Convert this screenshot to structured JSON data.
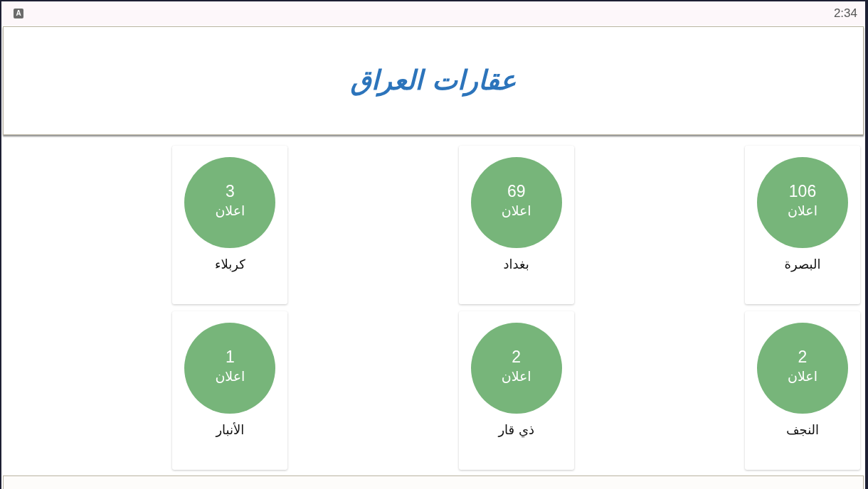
{
  "status_bar": {
    "notification_icon": "A",
    "time": "2:34"
  },
  "header": {
    "title": "عقارات العراق"
  },
  "cities": [
    {
      "name": "البصرة",
      "count": "106",
      "unit": "اعلان"
    },
    {
      "name": "بغداد",
      "count": "69",
      "unit": "اعلان"
    },
    {
      "name": "كربلاء",
      "count": "3",
      "unit": "اعلان"
    },
    {
      "name": "النجف",
      "count": "2",
      "unit": "اعلان"
    },
    {
      "name": "ذي قار",
      "count": "2",
      "unit": "اعلان"
    },
    {
      "name": "الأنبار",
      "count": "1",
      "unit": "اعلان"
    }
  ]
}
